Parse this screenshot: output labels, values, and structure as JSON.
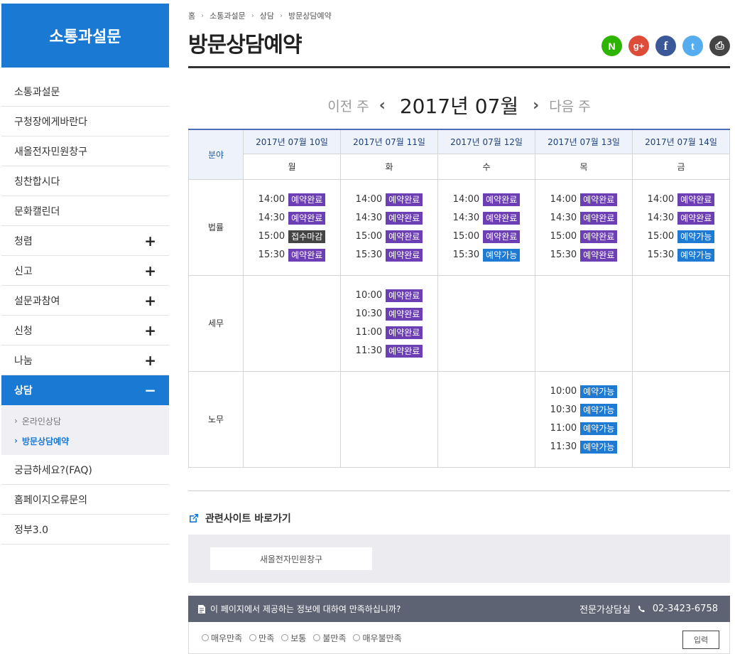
{
  "sidebar": {
    "title": "소통과설문",
    "items": [
      {
        "label": "소통과설문",
        "toggle": ""
      },
      {
        "label": "구청장에게바란다",
        "toggle": ""
      },
      {
        "label": "새올전자민원창구",
        "toggle": ""
      },
      {
        "label": "칭찬합시다",
        "toggle": ""
      },
      {
        "label": "문화캘린더",
        "toggle": ""
      },
      {
        "label": "청렴",
        "toggle": "+"
      },
      {
        "label": "신고",
        "toggle": "+"
      },
      {
        "label": "설문과참여",
        "toggle": "+"
      },
      {
        "label": "신청",
        "toggle": "+"
      },
      {
        "label": "나눔",
        "toggle": "+"
      },
      {
        "label": "상담",
        "toggle": "−"
      }
    ],
    "sub_items": [
      {
        "label": "온라인상담",
        "arrow": "›"
      },
      {
        "label": "방문상담예약",
        "arrow": "›"
      }
    ],
    "items_after": [
      {
        "label": "궁금하세요?(FAQ)"
      },
      {
        "label": "홈페이지오류문의"
      },
      {
        "label": "정부3.0"
      }
    ]
  },
  "breadcrumb": {
    "home": "홈",
    "level1": "소통과설문",
    "level2": "상담",
    "level3": "방문상담예약",
    "sep": "›"
  },
  "page_title": "방문상담예약",
  "share": {
    "naver": "N",
    "google": "g+",
    "facebook": "f",
    "twitter": "t",
    "print": "⎙"
  },
  "week_nav": {
    "prev": "이전 주",
    "prev_icon": "‹",
    "month": "2017년 07월",
    "next_icon": "›",
    "next": "다음 주"
  },
  "schedule": {
    "field_header": "분야",
    "dates": [
      "2017년 07월 10일",
      "2017년 07월 11일",
      "2017년 07월 12일",
      "2017년 07월 13일",
      "2017년 07월 14일"
    ],
    "days": [
      "월",
      "화",
      "수",
      "목",
      "금"
    ],
    "rows": [
      {
        "category": "법률",
        "cells": [
          [
            {
              "time": "14:00",
              "status": "예약완료",
              "kind": "done"
            },
            {
              "time": "14:30",
              "status": "예약완료",
              "kind": "done"
            },
            {
              "time": "15:00",
              "status": "접수마감",
              "kind": "closed"
            },
            {
              "time": "15:30",
              "status": "예약완료",
              "kind": "done"
            }
          ],
          [
            {
              "time": "14:00",
              "status": "예약완료",
              "kind": "done"
            },
            {
              "time": "14:30",
              "status": "예약완료",
              "kind": "done"
            },
            {
              "time": "15:00",
              "status": "예약완료",
              "kind": "done"
            },
            {
              "time": "15:30",
              "status": "예약완료",
              "kind": "done"
            }
          ],
          [
            {
              "time": "14:00",
              "status": "예약완료",
              "kind": "done"
            },
            {
              "time": "14:30",
              "status": "예약완료",
              "kind": "done"
            },
            {
              "time": "15:00",
              "status": "예약완료",
              "kind": "done"
            },
            {
              "time": "15:30",
              "status": "예약가능",
              "kind": "avail"
            }
          ],
          [
            {
              "time": "14:00",
              "status": "예약완료",
              "kind": "done"
            },
            {
              "time": "14:30",
              "status": "예약완료",
              "kind": "done"
            },
            {
              "time": "15:00",
              "status": "예약완료",
              "kind": "done"
            },
            {
              "time": "15:30",
              "status": "예약완료",
              "kind": "done"
            }
          ],
          [
            {
              "time": "14:00",
              "status": "예약완료",
              "kind": "done"
            },
            {
              "time": "14:30",
              "status": "예약완료",
              "kind": "done"
            },
            {
              "time": "15:00",
              "status": "예약가능",
              "kind": "avail"
            },
            {
              "time": "15:30",
              "status": "예약가능",
              "kind": "avail"
            }
          ]
        ]
      },
      {
        "category": "세무",
        "cells": [
          [],
          [
            {
              "time": "10:00",
              "status": "예약완료",
              "kind": "done"
            },
            {
              "time": "10:30",
              "status": "예약완료",
              "kind": "done"
            },
            {
              "time": "11:00",
              "status": "예약완료",
              "kind": "done"
            },
            {
              "time": "11:30",
              "status": "예약완료",
              "kind": "done"
            }
          ],
          [],
          [],
          []
        ]
      },
      {
        "category": "노무",
        "cells": [
          [],
          [],
          [],
          [
            {
              "time": "10:00",
              "status": "예약가능",
              "kind": "avail"
            },
            {
              "time": "10:30",
              "status": "예약가능",
              "kind": "avail"
            },
            {
              "time": "11:00",
              "status": "예약가능",
              "kind": "avail"
            },
            {
              "time": "11:30",
              "status": "예약가능",
              "kind": "avail"
            }
          ],
          []
        ]
      }
    ]
  },
  "related": {
    "title": "관련사이트 바로가기",
    "link": "새올전자민원창구"
  },
  "survey": {
    "question": "이 페이지에서 제공하는 정보에 대하여 만족하십니까?",
    "contact_label": "전문가상담실",
    "phone": "02-3423-6758",
    "options": [
      "매우만족",
      "만족",
      "보통",
      "불만족",
      "매우불만족"
    ],
    "submit": "입력"
  },
  "colors": {
    "accent": "#1a7ad3",
    "done": "#6c3fb5",
    "closed": "#444444",
    "avail": "#1f7ad3"
  }
}
